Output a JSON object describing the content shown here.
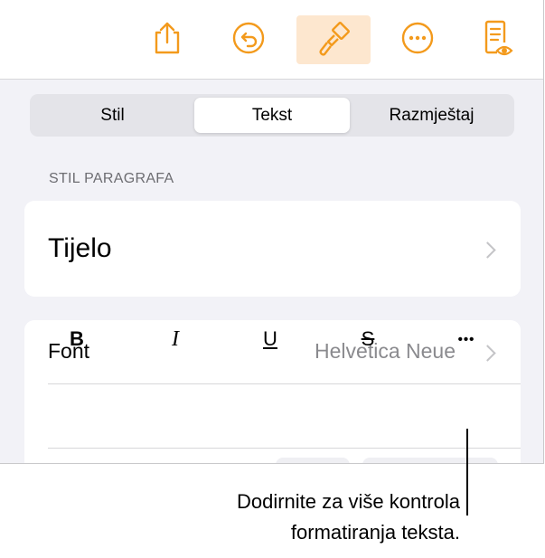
{
  "toolbar": {
    "icons": [
      "share-icon",
      "undo-icon",
      "paintbrush-icon",
      "more-icon",
      "reading-view-icon"
    ],
    "accent": "#f39a1c",
    "active_bg": "#fde7cf"
  },
  "tabs": [
    {
      "label": "Stil"
    },
    {
      "label": "Tekst",
      "selected": true
    },
    {
      "label": "Razmještaj"
    }
  ],
  "paragraph_style": {
    "section_label": "STIL PARAGRAFA",
    "value": "Tijelo"
  },
  "font": {
    "label": "Font",
    "value": "Helvetica Neue"
  },
  "format_buttons": {
    "bold": "B",
    "italic": "I",
    "underline": "U",
    "strikethrough": "S",
    "more": "•••"
  },
  "callout": {
    "line1": "Dodirnite za više kontrola",
    "line2": "formatiranja teksta."
  }
}
